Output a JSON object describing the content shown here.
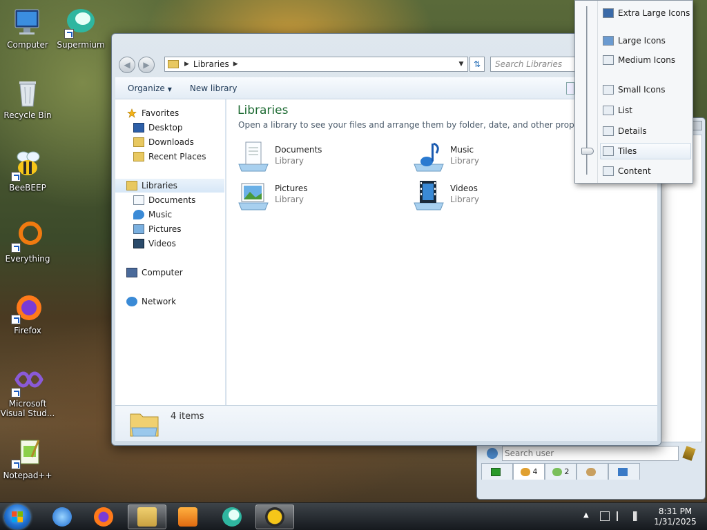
{
  "desktop": {
    "icons": [
      {
        "label": "Computer"
      },
      {
        "label": "Supermium"
      },
      {
        "label": "Recycle Bin"
      },
      {
        "label": "BeeBEEP"
      },
      {
        "label": "Everything"
      },
      {
        "label": "Firefox"
      },
      {
        "label": "Microsoft Visual Stud..."
      },
      {
        "label": "Notepad++"
      }
    ]
  },
  "explorer": {
    "address": {
      "crumb": "Libraries"
    },
    "search_placeholder": "Search Libraries",
    "commands": {
      "organize": "Organize",
      "new_library": "New library"
    },
    "nav": {
      "favorites": "Favorites",
      "desktop": "Desktop",
      "downloads": "Downloads",
      "recent_places": "Recent Places",
      "libraries": "Libraries",
      "documents": "Documents",
      "music": "Music",
      "pictures": "Pictures",
      "videos": "Videos",
      "computer": "Computer",
      "network": "Network"
    },
    "content": {
      "title": "Libraries",
      "description": "Open a library to see your files and arrange them by folder, date, and other properties.",
      "tiles": [
        {
          "name": "Documents",
          "type": "Library"
        },
        {
          "name": "Music",
          "type": "Library"
        },
        {
          "name": "Pictures",
          "type": "Library"
        },
        {
          "name": "Videos",
          "type": "Library"
        }
      ]
    },
    "details": {
      "count": "4 items"
    }
  },
  "view_menu": {
    "items": [
      {
        "label": "Extra Large Icons"
      },
      {
        "label": "Large Icons"
      },
      {
        "label": "Medium Icons"
      },
      {
        "label": "Small Icons"
      },
      {
        "label": "List"
      },
      {
        "label": "Details"
      },
      {
        "label": "Tiles"
      },
      {
        "label": "Content"
      }
    ]
  },
  "beebeep": {
    "search_placeholder": "Search user",
    "tabs": [
      {
        "count": "4"
      },
      {
        "count": "2"
      }
    ]
  },
  "taskbar": {
    "clock_time": "8:31 PM",
    "clock_date": "1/31/2025"
  },
  "colors": {
    "library_title": "#1e6b33",
    "accent_blue": "#1a66b2"
  }
}
